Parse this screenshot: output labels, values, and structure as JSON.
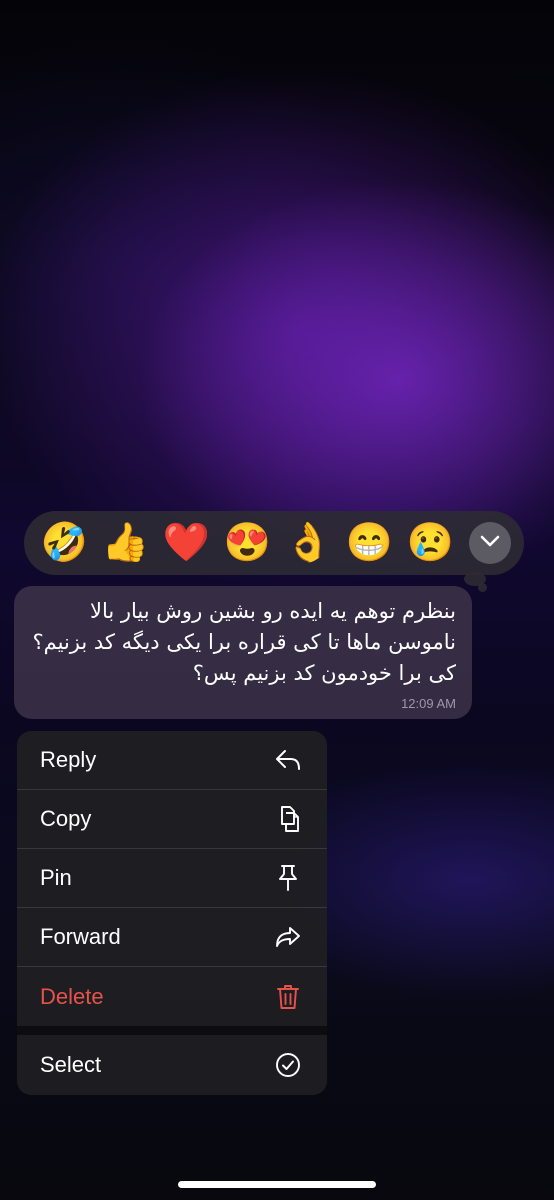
{
  "reactions": {
    "emojis": [
      "🤣",
      "👍",
      "❤️",
      "😍",
      "👌",
      "😁",
      "😢"
    ],
    "more_icon": "chevron-down-icon"
  },
  "message": {
    "lines": [
      "بنظرم توهم یه ایده رو بشین روش بیار بالا",
      "ناموسن ماها تا کی قراره برا یکی دیگه کد بزنیم؟",
      "کی برا خودمون کد بزنیم پس؟"
    ],
    "time": "12:09 AM"
  },
  "menu": {
    "items": [
      {
        "label": "Reply",
        "icon": "reply-icon"
      },
      {
        "label": "Copy",
        "icon": "copy-icon"
      },
      {
        "label": "Pin",
        "icon": "pin-icon"
      },
      {
        "label": "Forward",
        "icon": "forward-icon"
      },
      {
        "label": "Delete",
        "icon": "trash-icon"
      },
      {
        "label": "Select",
        "icon": "checkmark-circle-icon"
      }
    ]
  },
  "colors": {
    "delete": "#e5534b",
    "bubble": "#3a3046",
    "menu": "#1e1e22"
  }
}
